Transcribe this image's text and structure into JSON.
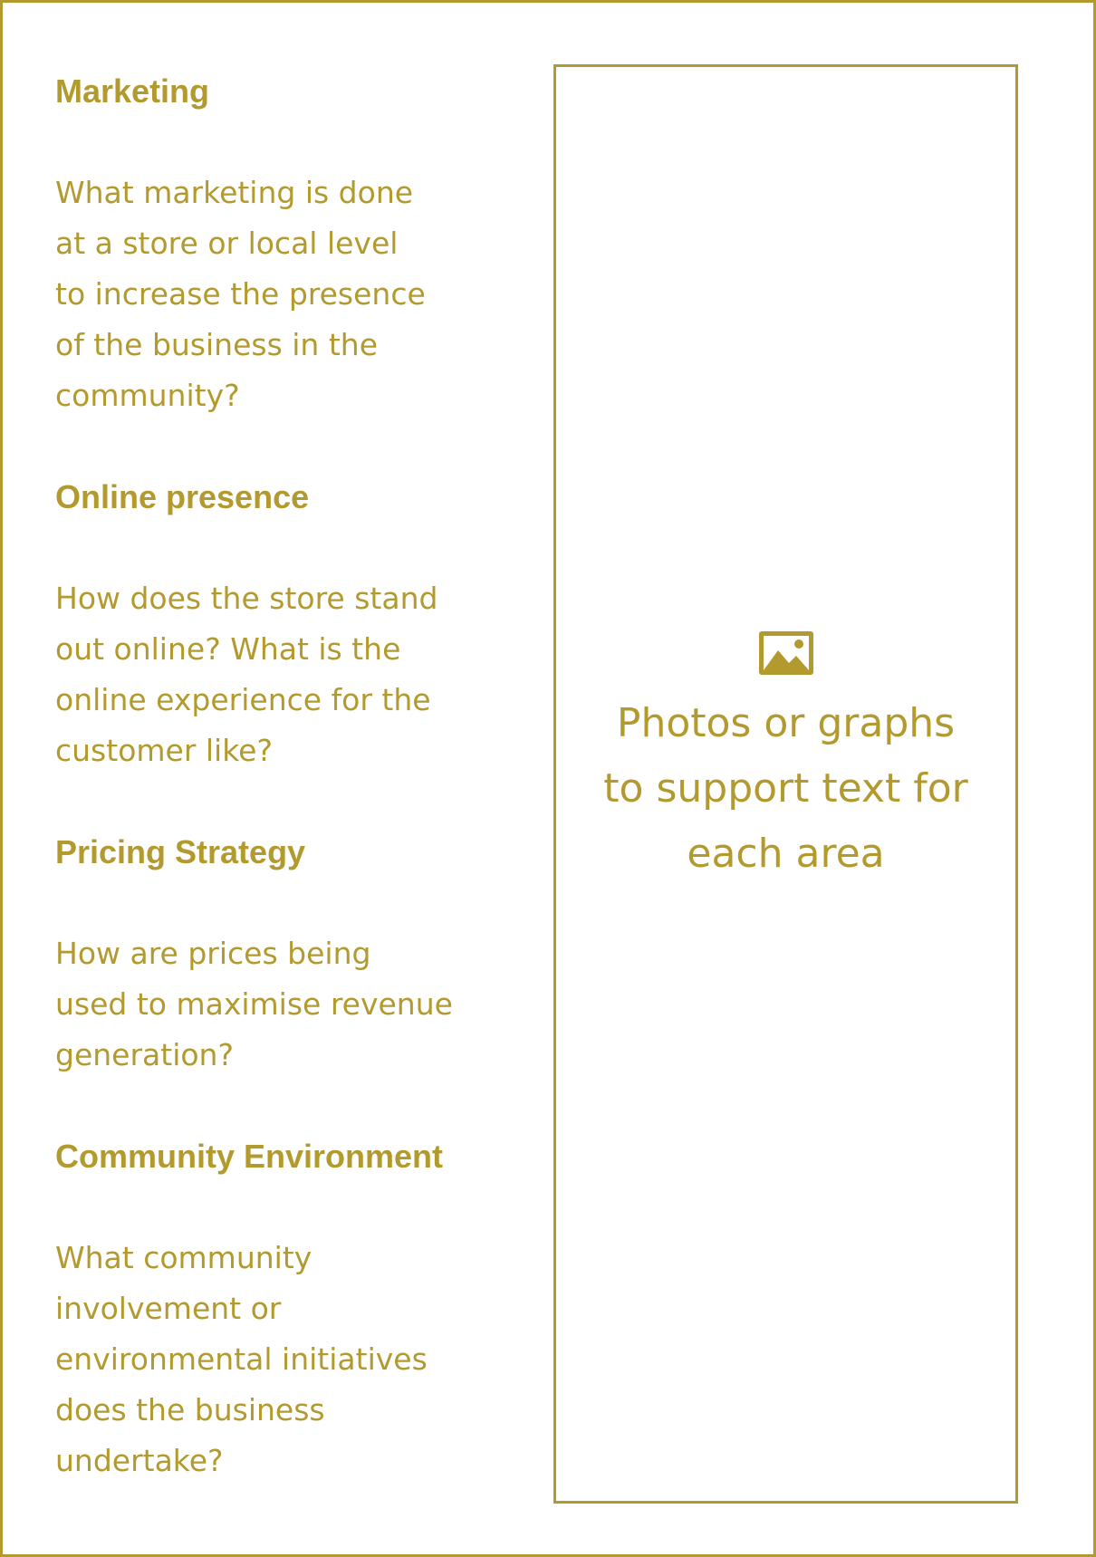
{
  "colors": {
    "accent": "#b39a2f",
    "background": "#ffffff"
  },
  "sections": [
    {
      "heading": "Marketing",
      "body": "What marketing is done\nat a store or local level\nto increase the presence\nof the business in the\ncommunity?"
    },
    {
      "heading": "Online presence",
      "body": "How does the store stand\nout online?  What is the\nonline experience for the\ncustomer like?"
    },
    {
      "heading": "Pricing Strategy",
      "body": "How are prices being\nused to maximise revenue\ngeneration?"
    },
    {
      "heading": "Community Environment",
      "body": "What community\ninvolvement or\nenvironmental initiatives\ndoes the business\nundertake?"
    }
  ],
  "image_placeholder": {
    "icon": "image-icon",
    "text": "Photos or graphs\nto support text for\neach area"
  }
}
